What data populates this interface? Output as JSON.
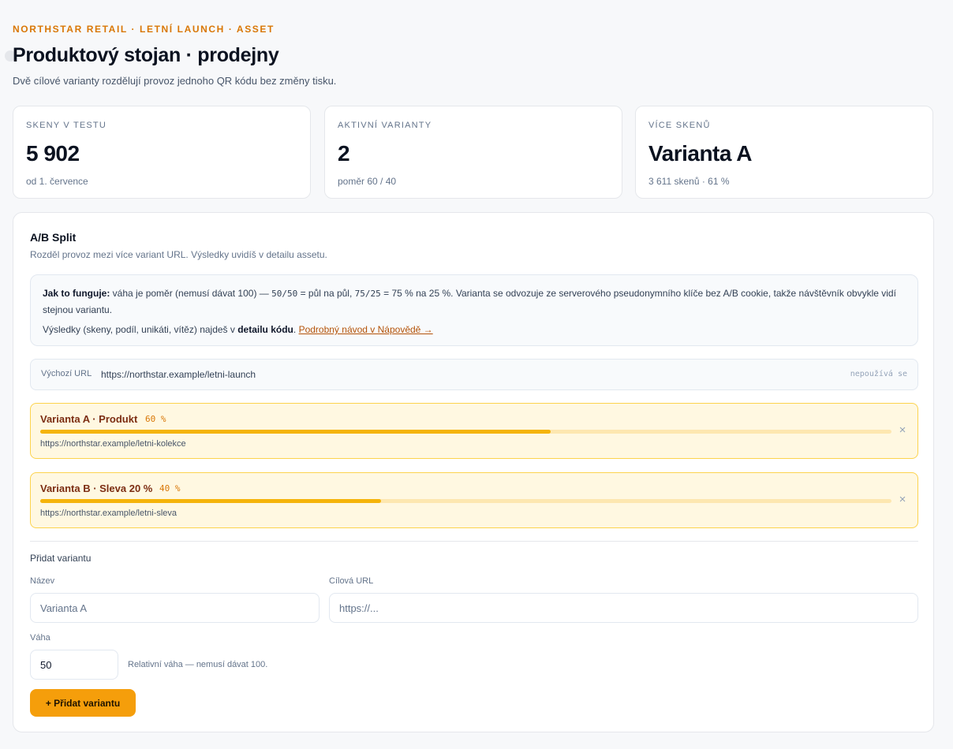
{
  "header": {
    "eyebrow": "NORTHSTAR RETAIL · LETNÍ LAUNCH · ASSET",
    "title": "Produktový stojan · prodejny",
    "subtitle": "Dvě cílové varianty rozdělují provoz jednoho QR kódu bez změny tisku."
  },
  "stats": [
    {
      "label": "SKENY V TESTU",
      "value": "5 902",
      "note": "od 1. července"
    },
    {
      "label": "AKTIVNÍ VARIANTY",
      "value": "2",
      "note": "poměr 60 / 40"
    },
    {
      "label": "VÍCE SKENŮ",
      "value": "Varianta A",
      "note": "3 611 skenů · 61 %"
    }
  ],
  "split": {
    "title": "A/B Split",
    "description": "Rozděl provoz mezi více variant URL. Výsledky uvidíš v detailu assetu.",
    "info": {
      "lead": "Jak to funguje:",
      "text_1": " váha je poměr (nemusí dávat 100) — ",
      "code_1": "50/50",
      "text_2": " = půl na půl, ",
      "code_2": "75/25",
      "text_3": " = 75 % na 25 %. Varianta se odvozuje ze serverového pseudonymního klíče bez A/B cookie, takže návštěvník obvykle vidí stejnou variantu.",
      "line2_pre": "Výsledky (skeny, podíl, unikáti, vítěz) najdeš v ",
      "line2_bold": "detailu kódu",
      "line2_post": ". ",
      "help_link": "Podrobný návod v Nápovědě →"
    },
    "default": {
      "label": "Výchozí URL",
      "url": "https://northstar.example/letni-launch",
      "state": "nepoužívá se"
    },
    "variants": [
      {
        "name": "Varianta A · Produkt",
        "weight_label": "60 %",
        "share": 0.6,
        "url": "https://northstar.example/letni-kolekce",
        "remove": "×"
      },
      {
        "name": "Varianta B · Sleva 20 %",
        "weight_label": "40 %",
        "share": 0.4,
        "url": "https://northstar.example/letni-sleva",
        "remove": "×"
      }
    ],
    "add": {
      "title": "Přidat variantu",
      "name_label": "Název",
      "name_placeholder": "Varianta A",
      "url_label": "Cílová URL",
      "url_placeholder": "https://...",
      "weight_label": "Váha",
      "weight_value": "50",
      "weight_hint": "Relativní váha — nemusí dávat 100.",
      "button": "+ Přidat variantu"
    }
  },
  "colors": {
    "accent": "#f59e0b",
    "bar_fill": "#f5b40a",
    "variant_bg": "#fff8e1",
    "eyebrow": "#d97706"
  }
}
